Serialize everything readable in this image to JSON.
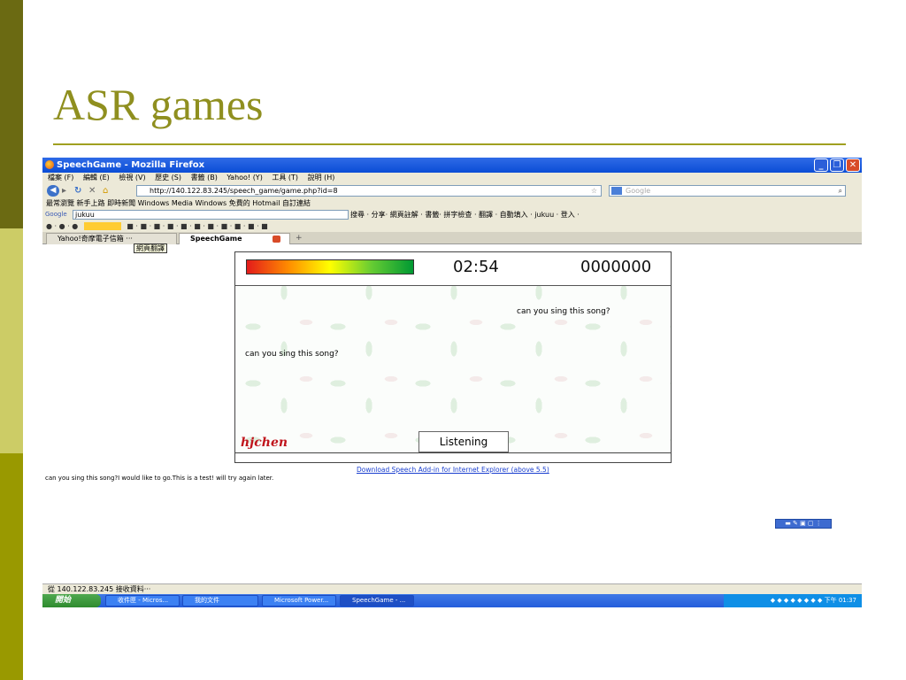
{
  "slide": {
    "title": "ASR games"
  },
  "browser": {
    "window_title": "SpeechGame - Mozilla Firefox",
    "menu": [
      "檔案 (F)",
      "編輯 (E)",
      "檢視 (V)",
      "歷史 (S)",
      "書籤 (B)",
      "Yahoo! (Y)",
      "工具 (T)",
      "說明 (H)"
    ],
    "url": "http://140.122.83.245/speech_game/game.php?id=8",
    "search_placeholder": "Google",
    "bookmarks": "最常瀏覽  新手上路  即時新聞  Windows Media  Windows  免費的 Hotmail  自訂連結",
    "google_toolbar_query": "jukuu",
    "google_toolbar_tools": "搜尋 ·  分享·  網頁註解 · 書籤· 拼字檢查 · 翻譯 · 自動填入 ·  jukuu   ·  登入 ·",
    "tabs": [
      {
        "label": "Yahoo!奇摩電子信箱 ···"
      },
      {
        "label": "SpeechGame"
      }
    ],
    "status_text": "從 140.122.83.245 接收資料···"
  },
  "game": {
    "tooltip": "網頁翻譯",
    "timer": "02:54",
    "score": "0000000",
    "meter_level": 1.0,
    "phrases": [
      {
        "text": "can you sing this song?"
      },
      {
        "text": "can you sing this song?"
      }
    ],
    "logo": "hjchen",
    "listen_button": "Listening"
  },
  "page": {
    "download_link": "Download Speech Add-in for Internet Explorer (above 5.5)",
    "transcript": "can you sing this song?I would like to go.This is a test! will try again later."
  },
  "taskbar": {
    "start": "開始",
    "tasks": [
      "收件匣 - Micros...",
      "我的文件",
      "Microsoft Power...",
      "SpeechGame - ..."
    ],
    "clock": "下午 01:37"
  },
  "colors": {
    "slide_title": "#8f8f1f",
    "titlebar": "#0b4dd6",
    "logo": "#c0141c",
    "link": "#1a3fcf"
  }
}
